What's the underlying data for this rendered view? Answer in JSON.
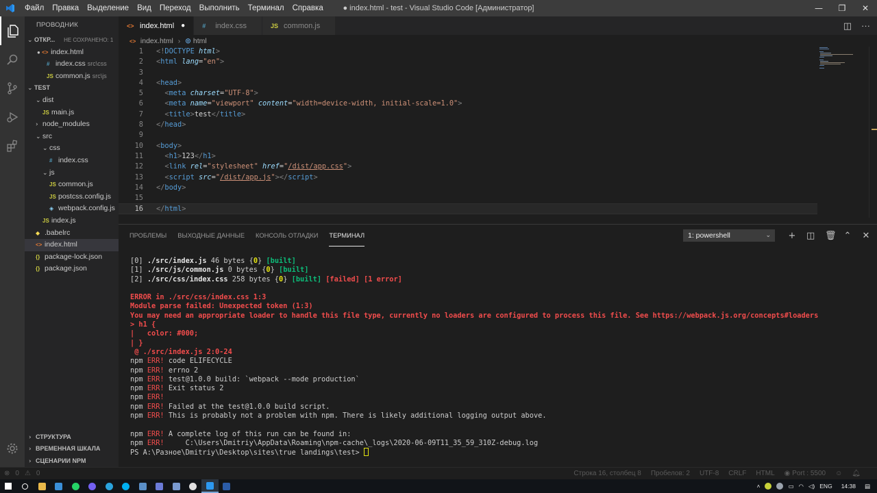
{
  "titlebar": {
    "menu": [
      "Файл",
      "Правка",
      "Выделение",
      "Вид",
      "Переход",
      "Выполнить",
      "Терминал",
      "Справка"
    ],
    "window_title": "● index.html - test - Visual Studio Code [Администратор]"
  },
  "sidebar": {
    "header": "ПРОВОДНИК",
    "open_editors_label": "ОТКР...",
    "unsaved_label": "НЕ СОХРАНЕНО: 1",
    "open_editors": [
      {
        "name": "index.html",
        "sub": "",
        "icon": "html-file-icon"
      },
      {
        "name": "index.css",
        "sub": "src\\css",
        "icon": "css-file-icon"
      },
      {
        "name": "common.js",
        "sub": "src\\js",
        "icon": "js-file-icon"
      }
    ],
    "project_label": "TEST",
    "tree": [
      {
        "name": "dist",
        "level": 1,
        "type": "folder",
        "open": true
      },
      {
        "name": "main.js",
        "level": 2,
        "type": "js"
      },
      {
        "name": "node_modules",
        "level": 1,
        "type": "folder",
        "open": false
      },
      {
        "name": "src",
        "level": 1,
        "type": "folder",
        "open": true
      },
      {
        "name": "css",
        "level": 2,
        "type": "folder",
        "open": true
      },
      {
        "name": "index.css",
        "level": 3,
        "type": "css"
      },
      {
        "name": "js",
        "level": 2,
        "type": "folder",
        "open": true
      },
      {
        "name": "common.js",
        "level": 3,
        "type": "js"
      },
      {
        "name": "postcss.config.js",
        "level": 3,
        "type": "js"
      },
      {
        "name": "webpack.config.js",
        "level": 3,
        "type": "wp"
      },
      {
        "name": "index.js",
        "level": 2,
        "type": "js"
      },
      {
        "name": ".babelrc",
        "level": 1,
        "type": "babel"
      },
      {
        "name": "index.html",
        "level": 1,
        "type": "html",
        "selected": true
      },
      {
        "name": "package-lock.json",
        "level": 1,
        "type": "json"
      },
      {
        "name": "package.json",
        "level": 1,
        "type": "json"
      }
    ],
    "bottom_sections": [
      "СТРУКТУРА",
      "ВРЕМЕННАЯ ШКАЛА",
      "СЦЕНАРИИ NPM"
    ]
  },
  "tabs": [
    {
      "label": "index.html",
      "icon": "html-file-icon",
      "active": true,
      "dirty": true
    },
    {
      "label": "index.css",
      "icon": "css-file-icon",
      "active": false,
      "dirty": false
    },
    {
      "label": "common.js",
      "icon": "js-file-icon",
      "active": false,
      "dirty": false
    }
  ],
  "breadcrumb": [
    "index.html",
    "html"
  ],
  "editor": {
    "current_line": 16,
    "lines": [
      [
        [
          "t-punc",
          "<!"
        ],
        [
          "t-doct",
          "DOCTYPE"
        ],
        [
          "t-text",
          " "
        ],
        [
          "t-dattr",
          "html"
        ],
        [
          "t-punc",
          ">"
        ]
      ],
      [
        [
          "t-punc",
          "<"
        ],
        [
          "t-tag",
          "html"
        ],
        [
          "t-text",
          " "
        ],
        [
          "t-attr",
          "lang"
        ],
        [
          "t-text",
          "="
        ],
        [
          "t-str",
          "\"en\""
        ],
        [
          "t-punc",
          ">"
        ]
      ],
      [],
      [
        [
          "t-punc",
          "<"
        ],
        [
          "t-tag",
          "head"
        ],
        [
          "t-punc",
          ">"
        ]
      ],
      [
        [
          "t-text",
          "  "
        ],
        [
          "t-punc",
          "<"
        ],
        [
          "t-tag",
          "meta"
        ],
        [
          "t-text",
          " "
        ],
        [
          "t-attr",
          "charset"
        ],
        [
          "t-text",
          "="
        ],
        [
          "t-str",
          "\"UTF-8\""
        ],
        [
          "t-punc",
          ">"
        ]
      ],
      [
        [
          "t-text",
          "  "
        ],
        [
          "t-punc",
          "<"
        ],
        [
          "t-tag",
          "meta"
        ],
        [
          "t-text",
          " "
        ],
        [
          "t-attr",
          "name"
        ],
        [
          "t-text",
          "="
        ],
        [
          "t-str",
          "\"viewport\""
        ],
        [
          "t-text",
          " "
        ],
        [
          "t-attr",
          "content"
        ],
        [
          "t-text",
          "="
        ],
        [
          "t-str",
          "\"width=device-width, initial-scale=1.0\""
        ],
        [
          "t-punc",
          ">"
        ]
      ],
      [
        [
          "t-text",
          "  "
        ],
        [
          "t-punc",
          "<"
        ],
        [
          "t-tag",
          "title"
        ],
        [
          "t-punc",
          ">"
        ],
        [
          "t-text",
          "test"
        ],
        [
          "t-punc",
          "</"
        ],
        [
          "t-tag",
          "title"
        ],
        [
          "t-punc",
          ">"
        ]
      ],
      [
        [
          "t-punc",
          "</"
        ],
        [
          "t-tag",
          "head"
        ],
        [
          "t-punc",
          ">"
        ]
      ],
      [],
      [
        [
          "t-punc",
          "<"
        ],
        [
          "t-tag",
          "body"
        ],
        [
          "t-punc",
          ">"
        ]
      ],
      [
        [
          "t-text",
          "  "
        ],
        [
          "t-punc",
          "<"
        ],
        [
          "t-tag",
          "h1"
        ],
        [
          "t-punc",
          ">"
        ],
        [
          "t-text",
          "123"
        ],
        [
          "t-punc",
          "</"
        ],
        [
          "t-tag",
          "h1"
        ],
        [
          "t-punc",
          ">"
        ]
      ],
      [
        [
          "t-text",
          "  "
        ],
        [
          "t-punc",
          "<"
        ],
        [
          "t-tag",
          "link"
        ],
        [
          "t-text",
          " "
        ],
        [
          "t-attr",
          "rel"
        ],
        [
          "t-text",
          "="
        ],
        [
          "t-str",
          "\"stylesheet\""
        ],
        [
          "t-text",
          " "
        ],
        [
          "t-attr",
          "href"
        ],
        [
          "t-text",
          "="
        ],
        [
          "t-str",
          "\""
        ],
        [
          "t-str t-link",
          "/dist/app.css"
        ],
        [
          "t-str",
          "\""
        ],
        [
          "t-punc",
          ">"
        ]
      ],
      [
        [
          "t-text",
          "  "
        ],
        [
          "t-punc",
          "<"
        ],
        [
          "t-tag",
          "script"
        ],
        [
          "t-text",
          " "
        ],
        [
          "t-attr",
          "src"
        ],
        [
          "t-text",
          "="
        ],
        [
          "t-str",
          "\""
        ],
        [
          "t-str t-link",
          "/dist/app.js"
        ],
        [
          "t-str",
          "\""
        ],
        [
          "t-punc",
          "></"
        ],
        [
          "t-tag",
          "script"
        ],
        [
          "t-punc",
          ">"
        ]
      ],
      [
        [
          "t-punc",
          "</"
        ],
        [
          "t-tag",
          "body"
        ],
        [
          "t-punc",
          ">"
        ]
      ],
      [],
      [
        [
          "t-punc",
          "</"
        ],
        [
          "t-tag",
          "html"
        ],
        [
          "t-punc",
          ">"
        ]
      ]
    ]
  },
  "panel": {
    "tabs": [
      "ПРОБЛЕМЫ",
      "ВЫХОДНЫЕ ДАННЫЕ",
      "КОНСОЛЬ ОТЛАДКИ",
      "ТЕРМИНАЛ"
    ],
    "active_tab": 3,
    "terminal_select": "1: powershell",
    "actions": [
      {
        "name": "new-terminal-icon",
        "glyph": "+"
      },
      {
        "name": "split-terminal-icon",
        "glyph": "◫"
      },
      {
        "name": "trash-icon",
        "glyph": "🗑"
      },
      {
        "name": "chevron-up-icon",
        "glyph": "⌃"
      },
      {
        "name": "close-icon",
        "glyph": "✕"
      }
    ]
  },
  "terminal": [
    [
      [
        "",
        "[0] "
      ],
      [
        "tb",
        "./src/index.js"
      ],
      [
        "",
        " 46 bytes {"
      ],
      [
        "ty",
        "0"
      ],
      [
        "",
        "} "
      ],
      [
        "tg",
        "[built]"
      ]
    ],
    [
      [
        "",
        "[1] "
      ],
      [
        "tb",
        "./src/js/common.js"
      ],
      [
        "",
        " 0 bytes {"
      ],
      [
        "ty",
        "0"
      ],
      [
        "",
        "} "
      ],
      [
        "tg",
        "[built]"
      ]
    ],
    [
      [
        "",
        "[2] "
      ],
      [
        "tb",
        "./src/css/index.css"
      ],
      [
        "",
        " 258 bytes {"
      ],
      [
        "ty",
        "0"
      ],
      [
        "",
        "} "
      ],
      [
        "tg",
        "[built]"
      ],
      [
        "",
        " "
      ],
      [
        "tr",
        "[failed]"
      ],
      [
        "",
        " "
      ],
      [
        "tr",
        "[1 error]"
      ]
    ],
    [],
    [
      [
        "tr",
        "ERROR in ./src/css/index.css 1:3"
      ]
    ],
    [
      [
        "tr",
        "Module parse failed: Unexpected token (1:3)"
      ]
    ],
    [
      [
        "tr",
        "You may need an appropriate loader to handle this file type, currently no loaders are configured to process this file. See https://webpack.js.org/concepts#loaders"
      ]
    ],
    [
      [
        "tr",
        "> h1 {"
      ]
    ],
    [
      [
        "tr",
        "|   color: #000;"
      ]
    ],
    [
      [
        "tr",
        "| }"
      ]
    ],
    [
      [
        "tr",
        " @ ./src/index.js 2:0-24"
      ]
    ],
    [
      [
        "",
        "npm "
      ],
      [
        "tr-n",
        "ERR!"
      ],
      [
        "",
        " code ELIFECYCLE"
      ]
    ],
    [
      [
        "",
        "npm "
      ],
      [
        "tr-n",
        "ERR!"
      ],
      [
        "",
        " errno 2"
      ]
    ],
    [
      [
        "",
        "npm "
      ],
      [
        "tr-n",
        "ERR!"
      ],
      [
        "",
        " test@1.0.0 build: `webpack --mode production`"
      ]
    ],
    [
      [
        "",
        "npm "
      ],
      [
        "tr-n",
        "ERR!"
      ],
      [
        "",
        " Exit status 2"
      ]
    ],
    [
      [
        "",
        "npm "
      ],
      [
        "tr-n",
        "ERR!"
      ]
    ],
    [
      [
        "",
        "npm "
      ],
      [
        "tr-n",
        "ERR!"
      ],
      [
        "",
        " Failed at the test@1.0.0 build script."
      ]
    ],
    [
      [
        "",
        "npm "
      ],
      [
        "tr-n",
        "ERR!"
      ],
      [
        "",
        " This is probably not a problem with npm. There is likely additional logging output above."
      ]
    ],
    [],
    [
      [
        "",
        "npm "
      ],
      [
        "tr-n",
        "ERR!"
      ],
      [
        "",
        " A complete log of this run can be found in:"
      ]
    ],
    [
      [
        "",
        "npm "
      ],
      [
        "tr-n",
        "ERR!"
      ],
      [
        "",
        "     C:\\Users\\Dmitriy\\AppData\\Roaming\\npm-cache\\_logs\\2020-06-09T11_35_59_310Z-debug.log"
      ]
    ],
    [
      [
        "",
        "PS A:\\Разное\\Dmitriy\\Desktop\\sites\\true landings\\test> "
      ],
      [
        "cursor",
        ""
      ]
    ]
  ],
  "statusbar": {
    "errors": "0",
    "warnings": "0",
    "position": "Строка 16, столбец 8",
    "spaces": "Пробелов: 2",
    "encoding": "UTF-8",
    "eol": "CRLF",
    "language": "HTML",
    "port": "Port : 5500"
  },
  "taskbar": {
    "apps": [
      "windows-start-icon",
      "search-icon",
      "file-explorer-icon",
      "app-icon",
      "whatsapp-icon",
      "viber-icon",
      "telegram-icon",
      "skype-icon",
      "app-icon",
      "app-icon",
      "app-icon",
      "chrome-icon",
      "vscode-icon",
      "powershell-icon"
    ],
    "language": "ENG",
    "time": "14:38"
  },
  "colors": {
    "titlebar": "#3c3c3c",
    "activitybar": "#333333",
    "sidebar": "#252526",
    "editor": "#1e1e1e",
    "error_red": "#f14c4c",
    "built_green": "#0dbc79",
    "terminal_yellow": "#e5e510"
  }
}
